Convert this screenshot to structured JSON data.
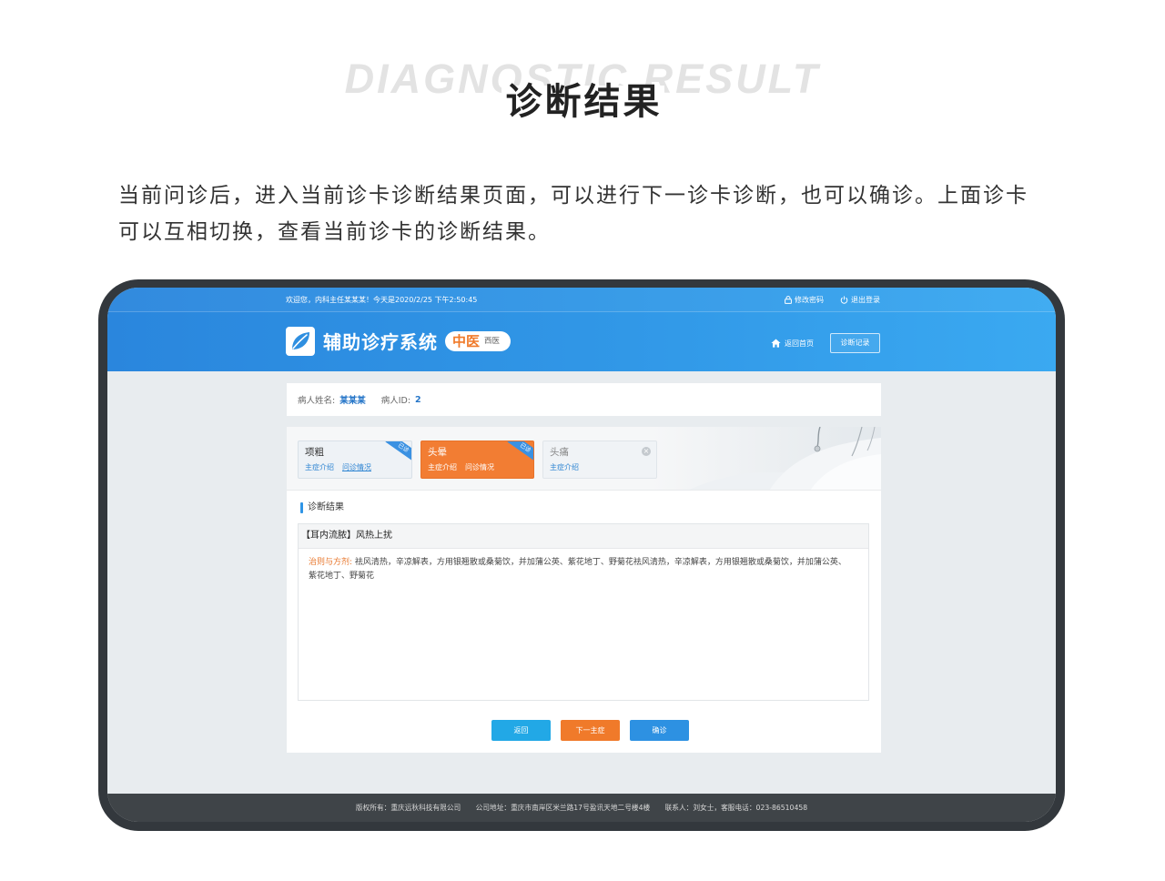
{
  "hero": {
    "watermark": "DIAGNOSTIC RESULT",
    "title": "诊断结果",
    "description": "当前问诊后，进入当前诊卡诊断结果页面，可以进行下一诊卡诊断，也可以确诊。上面诊卡可以互相切换，查看当前诊卡的诊断结果。"
  },
  "app": {
    "topbar": {
      "welcome": "欢迎您，内科主任某某某！今天是2020/2/25 下午2:50:45",
      "change_password": "修改密码",
      "change_password_icon": "lock-icon",
      "logout": "退出登录",
      "logout_icon": "power-icon"
    },
    "brand": {
      "logo_icon": "leaf-icon",
      "title": "辅助诊疗系统",
      "mode_active": "中医",
      "mode_other": "西医"
    },
    "nav": {
      "home": "返回首页",
      "home_icon": "home-icon",
      "records": "诊断记录"
    },
    "patient": {
      "name_label": "病人姓名:",
      "name": "某某某",
      "id_label": "病人ID:",
      "id": "2"
    },
    "cards": [
      {
        "title": "项粗",
        "links": [
          "主症介绍",
          "问诊情况"
        ],
        "badge": "已诊"
      },
      {
        "title": "头晕",
        "links": [
          "主症介绍",
          "问诊情况"
        ],
        "badge": "已诊"
      },
      {
        "title": "头痛",
        "links": [
          "主症介绍"
        ],
        "close_icon": "close-icon"
      }
    ],
    "result": {
      "section_title": "诊断结果",
      "heading": "【耳内流脓】风热上扰",
      "label": "治则与方剂:",
      "text": "祛风清热，辛凉解表，方用银翘散或桑菊饮，并加蒲公英、紫花地丁、野菊花祛风清热，辛凉解表，方用银翘散或桑菊饮，并加蒲公英、紫花地丁、野菊花"
    },
    "actions": {
      "back": "返回",
      "next": "下一主症",
      "confirm": "确诊"
    },
    "footer": {
      "copyright": "版权所有：重庆远秋科技有限公司",
      "address": "公司地址：重庆市南岸区米兰路17号盈讯天地二号楼4楼",
      "contact": "联系人：刘女士，客服电话：023-86510458"
    }
  },
  "colors": {
    "header-blue": "#2f95e6",
    "active-card": "#f27d33",
    "badge-blue": "#3a91e2",
    "link-blue": "#2d84d2",
    "treatment-label": "#e8772d",
    "btn-back": "#22a8e6",
    "btn-next": "#f07a2a",
    "btn-confirm": "#2d91e2"
  }
}
